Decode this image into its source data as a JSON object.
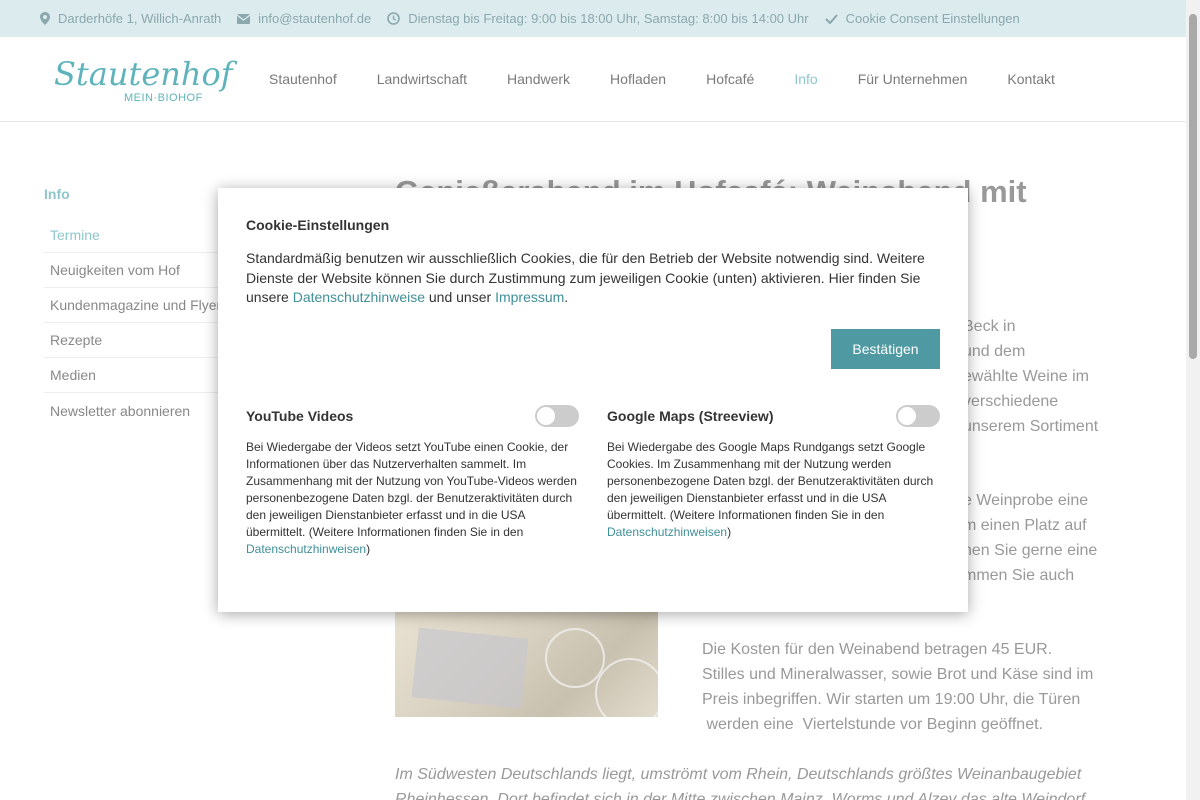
{
  "topbar": {
    "address": "Darderhöfe 1, Willich-Anrath",
    "email": "info@stautenhof.de",
    "hours": "Dienstag bis Freitag: 9:00 bis 18:00 Uhr, Samstag: 8:00 bis 14:00 Uhr",
    "cookie_link": "Cookie Consent Einstellungen"
  },
  "header": {
    "logo_text": "Stautenhof",
    "logo_sub": "MEIN·BIOHOF",
    "nav": [
      "Stautenhof",
      "Landwirtschaft",
      "Handwerk",
      "Hofladen",
      "Hofcafé",
      "Info",
      "Für Unternehmen",
      "Kontakt"
    ]
  },
  "sidebar": {
    "title": "Info",
    "items": [
      "Termine",
      "Neuigkeiten vom Hof",
      "Kundenmagazine und Flyer",
      "Rezepte",
      "Medien",
      "Newsletter abonnieren"
    ]
  },
  "article": {
    "title": "Genießerabend im Hofcafé: Weinabend mit",
    "p1": [
      "Beck in",
      "und dem",
      "ewählte Weine im",
      "verschiedene",
      "unserem Sortiment"
    ],
    "p2": [
      "e Weinprobe eine",
      "m einen Platz auf",
      "nen Sie gerne eine",
      "mmen Sie auch"
    ],
    "p3": [
      "Die Kosten für den Weinabend betragen 45 EUR.",
      "Stilles und Mineralwasser, sowie Brot und Käse sind im",
      "Preis inbegriffen. Wir starten um 19:00 Uhr, die Türen",
      " werden eine  Viertelstunde vor Beginn geöffnet."
    ],
    "italic": [
      "Im Südwesten Deutschlands liegt, umströmt vom Rhein, Deutschlands größtes Weinanbaugebiet",
      "Rheinhessen. Dort befindet sich in der Mitte zwischen Mainz, Worms und Alzey das alte Weindorf"
    ]
  },
  "modal": {
    "title": "Cookie-Einstellungen",
    "intro_before": "Standardmäßig benutzen wir ausschließlich Cookies, die für den Betrieb der Website notwendig sind. Weitere Dienste der Website können Sie durch Zustimmung zum jeweiligen Cookie (unten) aktivieren. Hier finden Sie unsere ",
    "intro_link1": "Datenschutzhinweise",
    "intro_middle": " und unser ",
    "intro_link2": "Impressum",
    "intro_after": ".",
    "confirm_label": "Bestätigen",
    "services": [
      {
        "title": "YouTube Videos",
        "desc": "Bei Wiedergabe der Videos setzt YouTube einen Cookie, der Informationen über das Nutzerverhalten sammelt. Im Zusammenhang mit der Nutzung von YouTube-Videos werden personenbezogene Daten bzgl. der Benutzeraktivitäten durch den jeweiligen Dienstanbieter erfasst und in die USA übermittelt. (Weitere Informationen finden Sie in den ",
        "link": "Datenschutzhinweisen",
        "after": ")",
        "enabled": false
      },
      {
        "title": "Google Maps (Streeview)",
        "desc": "Bei Wiedergabe des Google Maps Rundgangs setzt Google Cookies. Im Zusammenhang mit der Nutzung werden personenbezogene Daten bzgl. der Benutzeraktivitäten durch den jeweiligen Dienstanbieter erfasst und in die USA übermittelt. (Weitere Informationen finden Sie in den ",
        "link": "Datenschutzhinweisen",
        "after": ")",
        "enabled": false
      }
    ]
  },
  "colors": {
    "accent": "#8fc6cc",
    "button": "#4f9aa2",
    "topbar_bg": "#dcebee"
  }
}
